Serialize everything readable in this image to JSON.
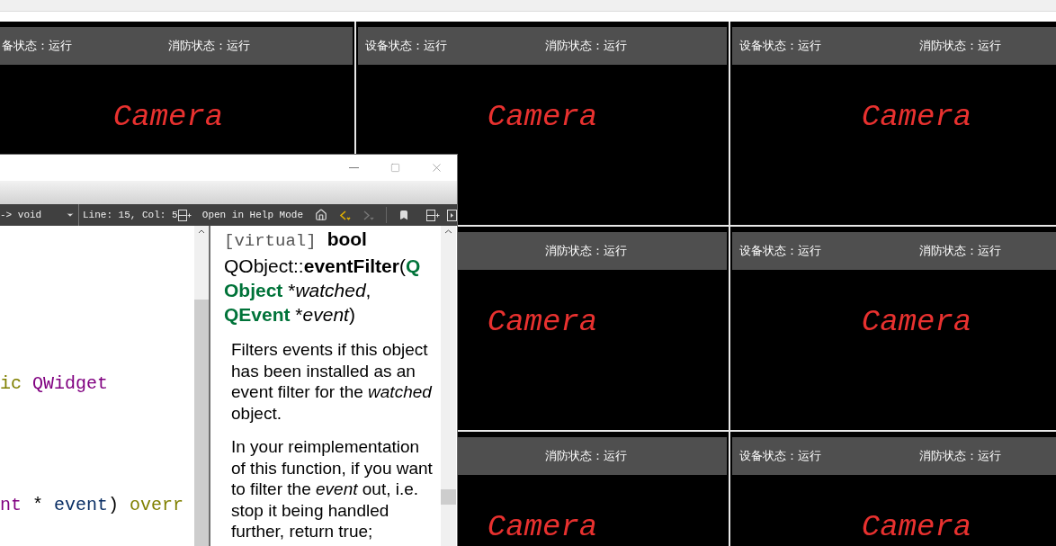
{
  "camera_grid": {
    "rows": [
      {
        "cells": [
          {
            "device_status": "备状态：运行",
            "fire_status": "消防状态：运行",
            "label": "Camera"
          },
          {
            "device_status": "设备状态：运行",
            "fire_status": "消防状态：运行",
            "label": "Camera"
          },
          {
            "device_status": "设备状态：运行",
            "fire_status": "消防状态：运行",
            "label": "Camera"
          }
        ]
      },
      {
        "cells": [
          "",
          {
            "fire_status": "消防状态：运行",
            "label": "Camera"
          },
          {
            "device_status": "设备状态：运行",
            "fire_status": "消防状态：运行",
            "label": "Camera"
          }
        ]
      },
      {
        "cells": [
          "",
          {
            "fire_status": "消防状态：运行",
            "label": "Camera"
          },
          {
            "device_status": "设备状态：运行",
            "fire_status": "消防状态：运行",
            "label": "Camera"
          }
        ]
      }
    ]
  },
  "editor": {
    "function_combo": "-> void",
    "position": "Line: 15, Col: 5",
    "code_lines": [
      [
        {
          "text": "ic ",
          "kind": "keyword"
        },
        {
          "text": "QWidget",
          "kind": "type"
        }
      ],
      [
        {
          "text": "nt",
          "kind": "type"
        },
        {
          "text": " * ",
          "kind": "plain"
        },
        {
          "text": "event",
          "kind": "ident"
        },
        {
          "text": ") ",
          "kind": "plain"
        },
        {
          "text": "overr",
          "kind": "keyword"
        }
      ]
    ]
  },
  "help": {
    "mode_button": "Open in Help Mode",
    "signature_lines": [
      [
        {
          "text": "[virtual]",
          "kind": "mono"
        },
        {
          "text": "bool",
          "kind": "bold"
        }
      ],
      [
        {
          "text": "QObject::",
          "kind": "plain"
        },
        {
          "text": "eventFilter",
          "kind": "bold"
        },
        {
          "text": "(",
          "kind": "plain"
        },
        {
          "text": "Q",
          "kind": "type"
        }
      ],
      [
        {
          "text": "Object",
          "kind": "type"
        },
        {
          "text": " *",
          "kind": "plain"
        },
        {
          "text": "watched",
          "kind": "italic"
        },
        {
          "text": ",",
          "kind": "plain"
        }
      ],
      [
        {
          "text": "QEvent",
          "kind": "type"
        },
        {
          "text": " *",
          "kind": "plain"
        },
        {
          "text": "event",
          "kind": "italic"
        },
        {
          "text": ")",
          "kind": "plain"
        }
      ]
    ],
    "paragraphs": [
      "Filters events if this object has been installed as an event filter for the *watched* object.",
      "In your reimplementation of this function, if you want to filter the *event* out, i.e. stop it being handled further, return true;"
    ]
  }
}
